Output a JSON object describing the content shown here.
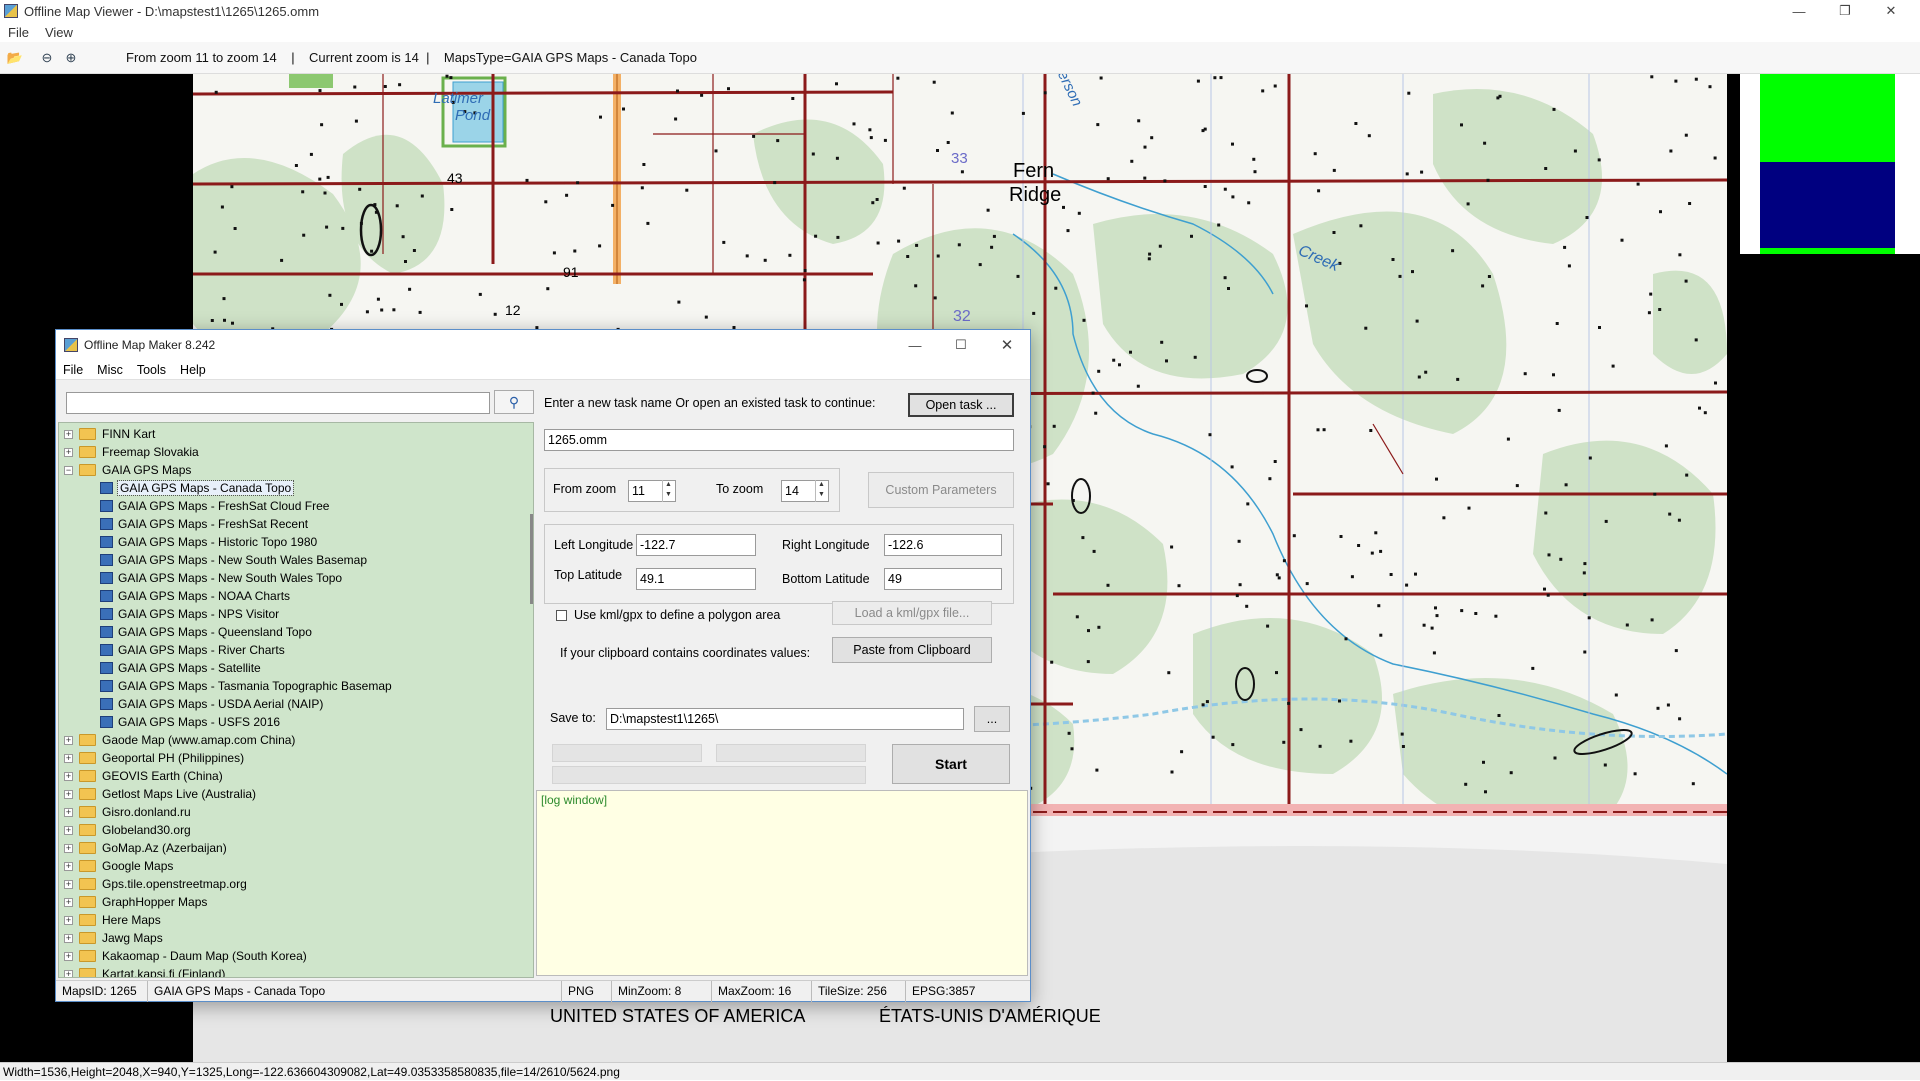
{
  "outer": {
    "title": "Offline Map Viewer - D:\\mapstest1\\1265\\1265.omm",
    "menu": [
      "File",
      "View"
    ],
    "toolbar_text": "From zoom 11 to zoom 14    |    Current zoom is 14  |    MapsType=GAIA GPS Maps - Canada Topo",
    "status": "Width=1536,Height=2048,X=940,Y=1325,Long=-122.636604309082,Lat=49.0353358580835,file=14/2610/5624.png"
  },
  "map": {
    "labels": {
      "latimer": "Latimer",
      "pond": "Pond",
      "n43": "43",
      "n12": "12",
      "n91": "91",
      "n33": "33",
      "n32": "32",
      "fern": "Fern",
      "ridge": "Ridge",
      "creek": "Creek",
      "jerson": "erson",
      "usa": "UNITED STATES OF AMERICA",
      "etats": "ÉTATS-UNIS D'AMÉRIQUE"
    },
    "colors": {
      "road": "#8b1a1a",
      "vegetation": "#cfe2c7",
      "water": "#cde8f5",
      "legend_green": "#00ff00",
      "legend_navy": "#000080"
    }
  },
  "omm": {
    "title": "Offline Map Maker 8.242",
    "menu": [
      "File",
      "Misc",
      "Tools",
      "Help"
    ],
    "search_value": "",
    "tree": [
      {
        "label": "FINN Kart",
        "type": "folder"
      },
      {
        "label": "Freemap Slovakia",
        "type": "folder"
      },
      {
        "label": "GAIA GPS Maps",
        "type": "folder-open"
      },
      {
        "label": "GAIA GPS Maps - Canada Topo",
        "type": "map",
        "selected": true
      },
      {
        "label": "GAIA GPS Maps - FreshSat Cloud Free",
        "type": "map"
      },
      {
        "label": "GAIA GPS Maps - FreshSat Recent",
        "type": "map"
      },
      {
        "label": "GAIA GPS Maps - Historic Topo 1980",
        "type": "map"
      },
      {
        "label": "GAIA GPS Maps - New South Wales Basemap",
        "type": "map"
      },
      {
        "label": "GAIA GPS Maps - New South Wales Topo",
        "type": "map"
      },
      {
        "label": "GAIA GPS Maps - NOAA Charts",
        "type": "map"
      },
      {
        "label": "GAIA GPS Maps - NPS Visitor",
        "type": "map"
      },
      {
        "label": "GAIA GPS Maps - Queensland Topo",
        "type": "map"
      },
      {
        "label": "GAIA GPS Maps - River Charts",
        "type": "map"
      },
      {
        "label": "GAIA GPS Maps - Satellite",
        "type": "map"
      },
      {
        "label": "GAIA GPS Maps - Tasmania Topographic Basemap",
        "type": "map"
      },
      {
        "label": "GAIA GPS Maps - USDA Aerial (NAIP)",
        "type": "map"
      },
      {
        "label": "GAIA GPS Maps - USFS 2016",
        "type": "map"
      },
      {
        "label": "Gaode Map (www.amap.com China)",
        "type": "folder"
      },
      {
        "label": "Geoportal PH (Philippines)",
        "type": "folder"
      },
      {
        "label": "GEOVIS Earth (China)",
        "type": "folder"
      },
      {
        "label": "Getlost Maps Live (Australia)",
        "type": "folder"
      },
      {
        "label": "Gisro.donland.ru",
        "type": "folder"
      },
      {
        "label": "Globeland30.org",
        "type": "folder"
      },
      {
        "label": "GoMap.Az (Azerbaijan)",
        "type": "folder"
      },
      {
        "label": "Google Maps",
        "type": "folder"
      },
      {
        "label": "Gps.tile.openstreetmap.org",
        "type": "folder"
      },
      {
        "label": "GraphHopper Maps",
        "type": "folder"
      },
      {
        "label": "Here Maps",
        "type": "folder"
      },
      {
        "label": "Jawg Maps",
        "type": "folder"
      },
      {
        "label": "Kakaomap - Daum Map (South Korea)",
        "type": "folder"
      },
      {
        "label": "Kartat.kapsi.fi (Finland)",
        "type": "folder"
      }
    ],
    "task_prompt": "Enter a new task name Or open an existed task to continue:",
    "open_task": "Open task ...",
    "task_name": "1265.omm",
    "from_zoom_label": "From zoom",
    "from_zoom": "11",
    "to_zoom_label": "To zoom",
    "to_zoom": "14",
    "custom_params": "Custom Parameters",
    "left_lon_label": "Left Longitude",
    "left_lon": "-122.7",
    "right_lon_label": "Right Longitude",
    "right_lon": "-122.6",
    "top_lat_label": "Top Latitude",
    "top_lat": "49.1",
    "bottom_lat_label": "Bottom Latitude",
    "bottom_lat": "49",
    "kml_label": "Use kml/gpx to define a polygon area",
    "kml_checked": false,
    "load_kml": "Load a kml/gpx file...",
    "clipboard_label": "If your clipboard contains coordinates values:",
    "paste": "Paste from Clipboard",
    "save_label": "Save to:",
    "save_path": "D:\\mapstest1\\1265\\",
    "browse": "...",
    "start": "Start",
    "log": "[log window]",
    "status": [
      "MapsID: 1265",
      "GAIA GPS Maps - Canada Topo",
      "PNG",
      "MinZoom: 8",
      "MaxZoom: 16",
      "TileSize: 256",
      "EPSG:3857"
    ]
  }
}
